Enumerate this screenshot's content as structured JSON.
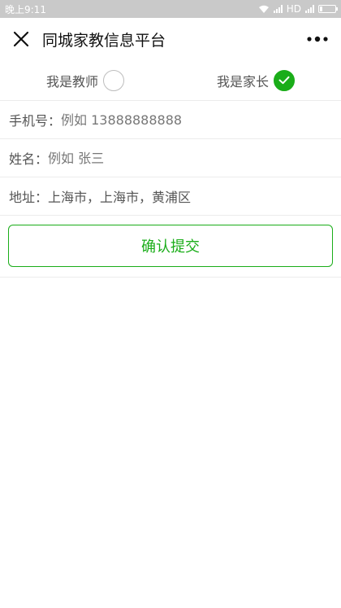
{
  "status_bar": {
    "time": "晚上9:11",
    "network": "HD"
  },
  "nav": {
    "title": "同城家教信息平台",
    "close_icon": "close-icon",
    "more_icon": "more-dots-icon"
  },
  "roles": [
    {
      "label": "我是教师",
      "checked": false
    },
    {
      "label": "我是家长",
      "checked": true
    }
  ],
  "form": {
    "phone": {
      "label": "手机号：",
      "placeholder": "例如 13888888888"
    },
    "name": {
      "label": "姓名：",
      "placeholder": "例如 张三"
    },
    "address": {
      "label": "地址：",
      "value": "上海市，上海市，黄浦区"
    }
  },
  "submit_label": "确认提交",
  "colors": {
    "accent": "#1aad19",
    "status_bar": "#c9c9c9"
  }
}
